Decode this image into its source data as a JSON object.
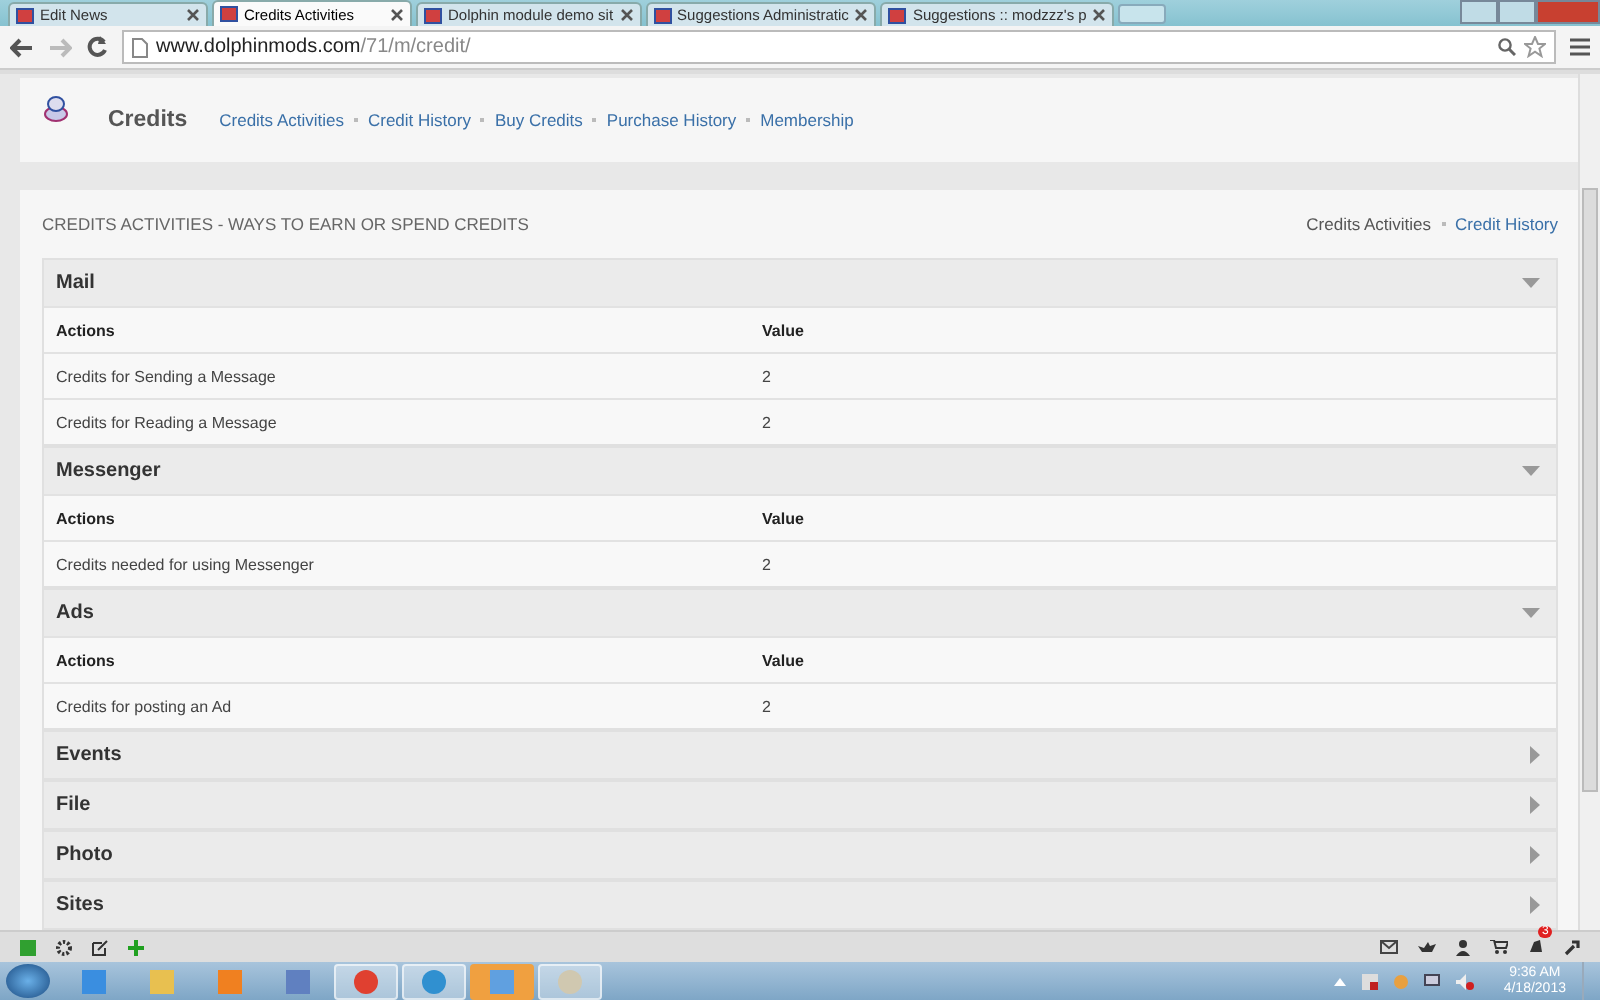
{
  "browser": {
    "tabs": [
      {
        "title": "Edit News",
        "selected": false
      },
      {
        "title": "Credits Activities",
        "selected": true
      },
      {
        "title": "Dolphin module demo sit",
        "selected": false
      },
      {
        "title": "Suggestions Administratic",
        "selected": false
      },
      {
        "title": "Suggestions :: modzzz's p",
        "selected": false
      }
    ],
    "url": {
      "domain": "www.dolphinmods.com",
      "path": "/71/m/credit/"
    }
  },
  "header": {
    "title": "Credits",
    "nav": [
      {
        "label": "Credits Activities"
      },
      {
        "label": "Credit History"
      },
      {
        "label": "Buy Credits"
      },
      {
        "label": "Purchase History"
      },
      {
        "label": "Membership"
      }
    ]
  },
  "panel": {
    "heading": "CREDITS ACTIVITIES - WAYS TO EARN OR SPEND CREDITS",
    "links": [
      {
        "label": "Credits Activities",
        "selected": true
      },
      {
        "label": "Credit History",
        "selected": false
      }
    ],
    "sections": [
      {
        "title": "Mail",
        "expanded": true,
        "columns": [
          "Actions",
          "Value"
        ],
        "rows": [
          {
            "action": "Credits for Sending a Message",
            "value": "2"
          },
          {
            "action": "Credits for Reading a Message",
            "value": "2"
          }
        ]
      },
      {
        "title": "Messenger",
        "expanded": true,
        "columns": [
          "Actions",
          "Value"
        ],
        "rows": [
          {
            "action": "Credits needed for using Messenger",
            "value": "2"
          }
        ]
      },
      {
        "title": "Ads",
        "expanded": true,
        "columns": [
          "Actions",
          "Value"
        ],
        "rows": [
          {
            "action": "Credits for posting an Ad",
            "value": "2"
          }
        ]
      },
      {
        "title": "Events",
        "expanded": false
      },
      {
        "title": "File",
        "expanded": false
      },
      {
        "title": "Photo",
        "expanded": false
      },
      {
        "title": "Sites",
        "expanded": false
      }
    ]
  },
  "tray": {
    "badge": "3",
    "time": "9:36 AM",
    "date": "4/18/2013"
  }
}
